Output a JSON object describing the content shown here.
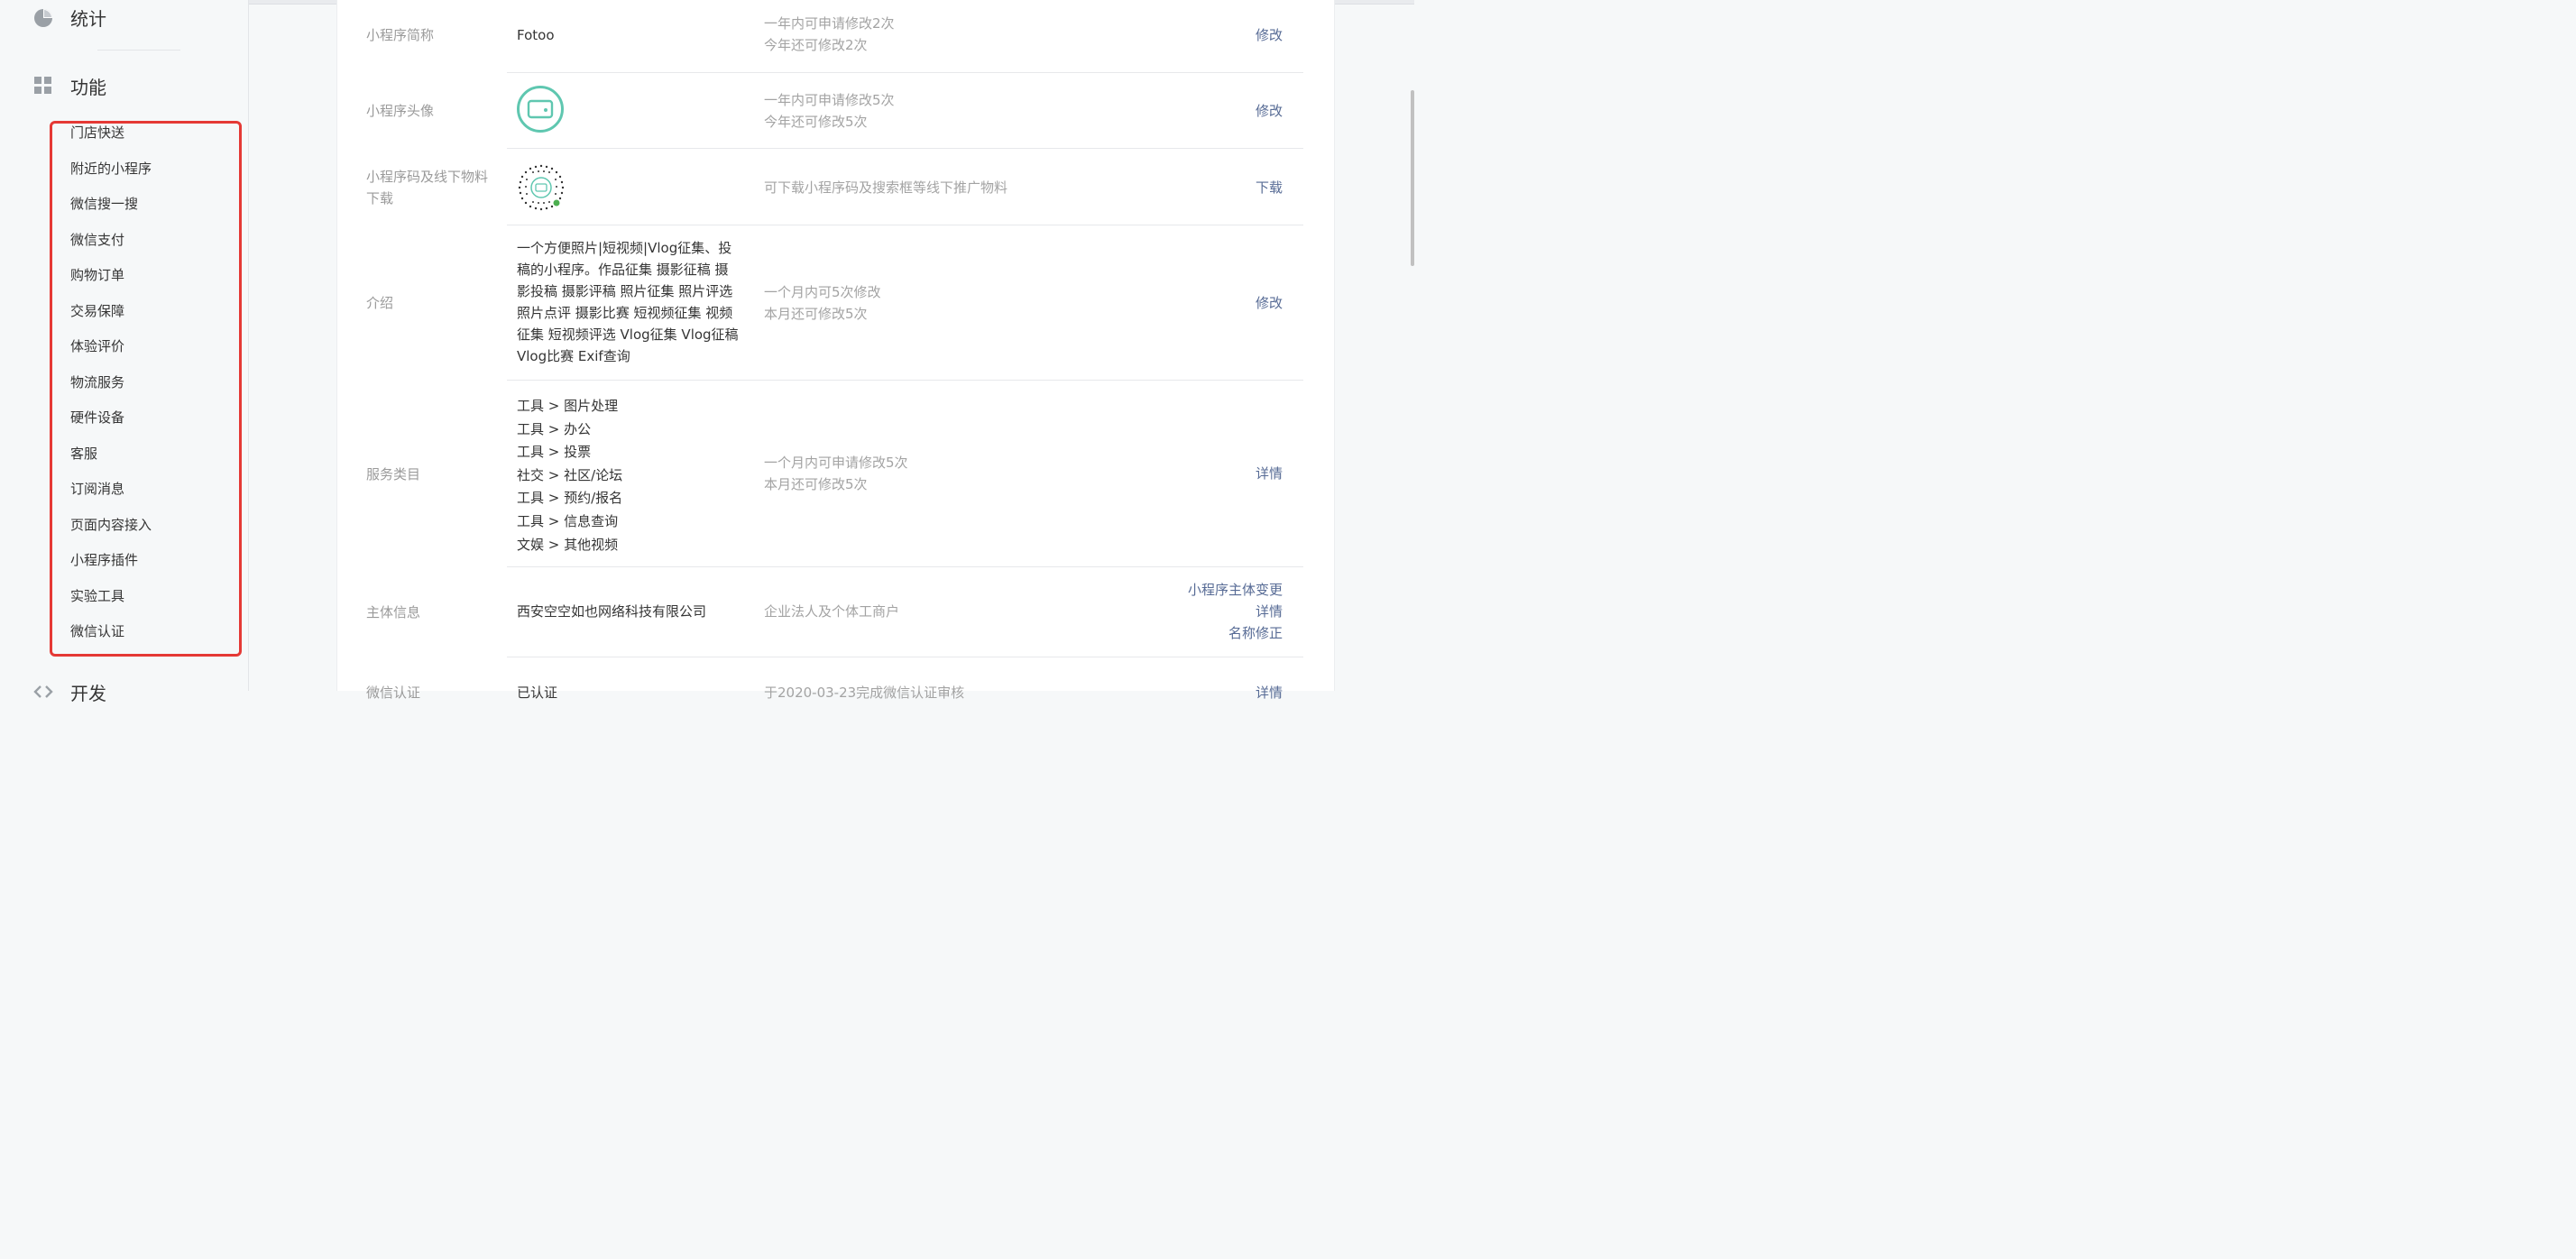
{
  "sidebar": {
    "stats_label": "统计",
    "functions_label": "功能",
    "dev_label": "开发",
    "items": [
      {
        "label": "门店快送"
      },
      {
        "label": "附近的小程序"
      },
      {
        "label": "微信搜一搜"
      },
      {
        "label": "微信支付"
      },
      {
        "label": "购物订单"
      },
      {
        "label": "交易保障"
      },
      {
        "label": "体验评价"
      },
      {
        "label": "物流服务"
      },
      {
        "label": "硬件设备"
      },
      {
        "label": "客服"
      },
      {
        "label": "订阅消息"
      },
      {
        "label": "页面内容接入"
      },
      {
        "label": "小程序插件"
      },
      {
        "label": "实验工具"
      },
      {
        "label": "微信认证"
      }
    ]
  },
  "rows": {
    "short_name": {
      "label": "小程序简称",
      "value": "Fotoo",
      "hint1": "一年内可申请修改2次",
      "hint2": "今年还可修改2次",
      "action": "修改"
    },
    "avatar": {
      "label": "小程序头像",
      "hint1": "一年内可申请修改5次",
      "hint2": "今年还可修改5次",
      "action": "修改"
    },
    "qrcode": {
      "label1": "小程序码及线下物料",
      "label2": "下载",
      "hint": "可下载小程序码及搜索框等线下推广物料",
      "action": "下载"
    },
    "intro": {
      "label": "介绍",
      "lines": [
        "一个方便照片|短视频|Vlog征集、投",
        "稿的小程序。作品征集 摄影征稿 摄",
        "影投稿 摄影评稿 照片征集 照片评选",
        "照片点评 摄影比赛 短视频征集 视频",
        "征集 短视频评选 Vlog征集 Vlog征稿",
        "Vlog比赛 Exif查询"
      ],
      "hint1": "一个月内可5次修改",
      "hint2": "本月还可修改5次",
      "action": "修改"
    },
    "category": {
      "label": "服务类目",
      "lines": [
        "工具 > 图片处理",
        "工具 > 办公",
        "工具 > 投票",
        "社交 > 社区/论坛",
        "工具 > 预约/报名",
        "工具 > 信息查询",
        "文娱 > 其他视频"
      ],
      "hint1": "一个月内可申请修改5次",
      "hint2": "本月还可修改5次",
      "action": "详情"
    },
    "entity": {
      "label": "主体信息",
      "value": "西安空空如也网络科技有限公司",
      "hint": "企业法人及个体工商户",
      "action1": "小程序主体变更",
      "action2": "详情",
      "action3": "名称修正"
    },
    "cert": {
      "label": "微信认证",
      "value": "已认证",
      "hint": "于2020-03-23完成微信认证审核",
      "action": "详情"
    }
  },
  "colors": {
    "link": "#576b95",
    "highlight": "#e53935",
    "avatar_ring": "#5fc7b0"
  }
}
